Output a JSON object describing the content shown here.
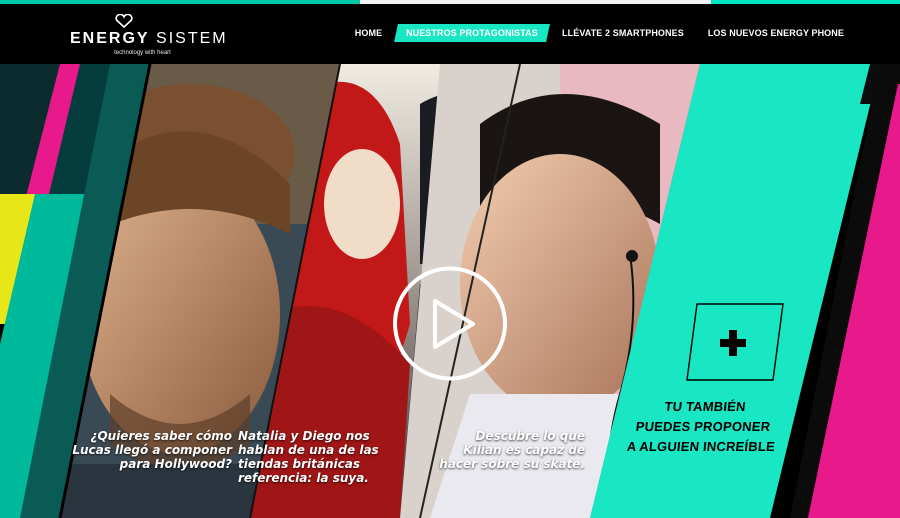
{
  "header": {
    "logo": {
      "brand_bold": "ENERGY",
      "brand_light": "SISTEM",
      "tagline": "technology with heart"
    },
    "nav": [
      {
        "label": "HOME",
        "active": false
      },
      {
        "label": "NUESTROS PROTAGONISTAS",
        "active": true
      },
      {
        "label": "LLÉVATE 2 SMARTPHONES",
        "active": false
      },
      {
        "label": "LOS NUEVOS ENERGY PHONE",
        "active": false
      }
    ]
  },
  "stories": [
    {
      "caption": "¿Quieres saber cómo Lucas llegó a componer para Hollywood?"
    },
    {
      "caption": "Natalia y Diego nos hablan de una de las tiendas británicas referencia: la suya."
    },
    {
      "caption": "Descubre lo que Kilian es capaz de hacer sobre su skate."
    }
  ],
  "cta": {
    "line1": "TU TAMBIÉN",
    "line2": "PUEDES PROPONER",
    "line3": "A ALGUIEN INCREÍBLE"
  },
  "colors": {
    "accent": "#19e6c3",
    "magenta": "#e8198b",
    "yellow": "#e6e619",
    "dark_teal": "#0a3d3a"
  },
  "icons": {
    "play": "play-icon",
    "plus": "plus-icon",
    "heart": "heart-logo-icon"
  }
}
